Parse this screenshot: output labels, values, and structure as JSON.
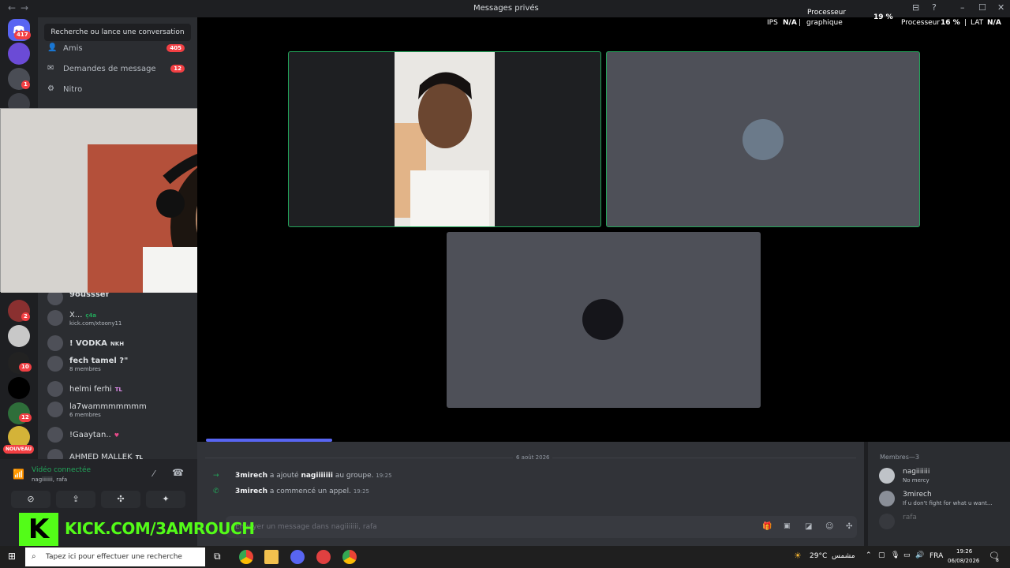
{
  "window": {
    "title": "Messages privés",
    "back": "←",
    "forward": "→",
    "minimize": "–",
    "maximize": "☐",
    "close": "✕",
    "inbox_icon": "⊟",
    "help_icon": "?"
  },
  "overlay": {
    "cpu_label_top": "Processeur",
    "cpu_top_pct": "19 %",
    "ips_label": "IPS",
    "ips_value": "N/A",
    "gpu_label": "graphique",
    "cpu_label": "Processeur",
    "cpu_value": "16 %",
    "lat_label": "LAT",
    "lat_value": "N/A"
  },
  "rail": {
    "main_badge": "417",
    "badges": [
      "1",
      "2",
      "10",
      "12"
    ],
    "new_label": "NOUVEAU"
  },
  "sidebar": {
    "search_placeholder": "Recherche ou lance une conversation",
    "nav": [
      {
        "label": "Amis",
        "count": "405",
        "icon": "👤"
      },
      {
        "label": "Demandes de message",
        "count": "12",
        "icon": "✉"
      },
      {
        "label": "Nitro",
        "count": "",
        "icon": "⚙"
      }
    ],
    "dms": [
      {
        "name": "9ousssef",
        "sub": "",
        "tag": ""
      },
      {
        "name": "X...",
        "sub": "kick.com/xtoony11",
        "tag": "ç4a"
      },
      {
        "name": "! VODKA",
        "sub": "",
        "tag": "NKH"
      },
      {
        "name": "fech tamel ?\"",
        "sub": "8 membres",
        "tag": ""
      },
      {
        "name": "helmi ferhi",
        "sub": "",
        "tag": "TL"
      },
      {
        "name": "la7wammmmmmm",
        "sub": "6 membres",
        "tag": ""
      },
      {
        "name": "!Gaaytan..",
        "sub": "",
        "tag": "♥"
      },
      {
        "name": "AHMED MALLEK",
        "sub": "",
        "tag": "TL"
      }
    ]
  },
  "voice": {
    "status": "Vidéo connectée",
    "channel": "nagiiiiiii, rafa"
  },
  "chat": {
    "date": "6 août 2026",
    "messages": [
      {
        "user": "3mirech",
        "text": "a ajouté",
        "target": "nagiiiiiii",
        "rest": "au groupe.",
        "time": "19:25"
      },
      {
        "user": "3mirech",
        "text": "a commencé un appel.",
        "target": "",
        "rest": "",
        "time": "19:25"
      }
    ],
    "input_placeholder": "Envoyer un message dans nagiiiiiii, rafa"
  },
  "members": {
    "header": "Membres—3",
    "list": [
      {
        "name": "nagiiiiiii",
        "status": "No mercy"
      },
      {
        "name": "3mirech",
        "status": "If u don't fight for what u want..."
      },
      {
        "name": "rafa",
        "status": ""
      }
    ]
  },
  "kick": {
    "logo": "K",
    "text": "KICK.COM/3AMROUCH"
  },
  "taskbar": {
    "search_placeholder": "Tapez ici pour effectuer une recherche",
    "weather": "29°C",
    "weather_text": "مشمس",
    "lang": "FRA",
    "time": "19:26",
    "date": "06/08/2026",
    "notif_count": "8"
  },
  "colors": {
    "green": "#23a55a",
    "red": "#f23f43",
    "kick": "#53fc18",
    "blurple": "#5865f2"
  }
}
